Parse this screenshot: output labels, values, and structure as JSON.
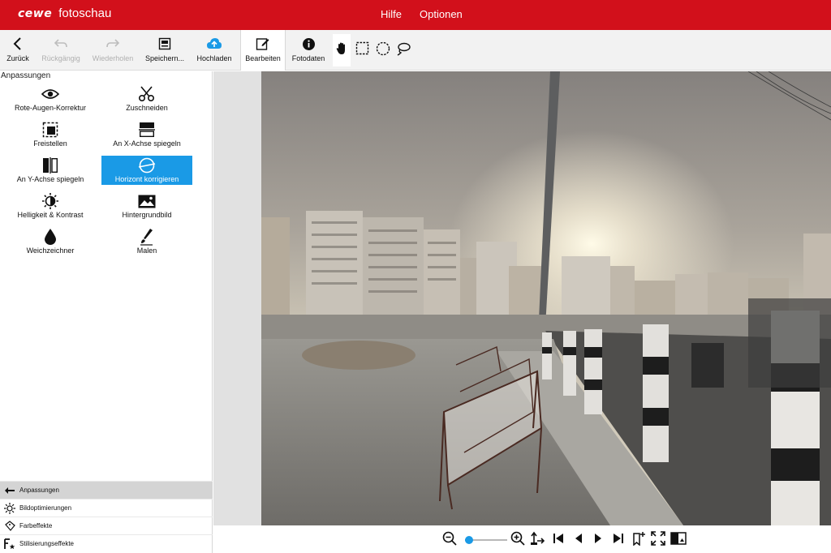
{
  "app": {
    "brand": "cewe",
    "name": "fotoschau"
  },
  "menu": {
    "items": [
      "Hilfe",
      "Optionen"
    ]
  },
  "toolbar": {
    "back": "Zurück",
    "undo": "Rückgängig",
    "redo": "Wiederholen",
    "save": "Speichern...",
    "upload": "Hochladen",
    "edit": "Bearbeiten",
    "photodata": "Fotodaten"
  },
  "panel": {
    "title": "Anpassungen",
    "tools": [
      {
        "label": "Rote-Augen-Korrektur",
        "icon": "eye-icon"
      },
      {
        "label": "Zuschneiden",
        "icon": "scissors-icon"
      },
      {
        "label": "Freistellen",
        "icon": "cutout-icon"
      },
      {
        "label": "An X-Achse spiegeln",
        "icon": "flip-x-icon"
      },
      {
        "label": "An Y-Achse spiegeln",
        "icon": "flip-y-icon"
      },
      {
        "label": "Horizont korrigieren",
        "icon": "horizon-icon"
      },
      {
        "label": "Helligkeit & Kontrast",
        "icon": "brightness-icon"
      },
      {
        "label": "Hintergrundbild",
        "icon": "image-icon"
      },
      {
        "label": "Weichzeichner",
        "icon": "drop-icon"
      },
      {
        "label": "Malen",
        "icon": "brush-icon"
      }
    ],
    "selected_tool": "Horizont korrigieren",
    "sections": [
      {
        "label": "Anpassungen",
        "icon": "arrow-left-icon"
      },
      {
        "label": "Bildoptimierungen",
        "icon": "sun-icon"
      },
      {
        "label": "Farbeffekte",
        "icon": "palette-icon"
      },
      {
        "label": "Stilisierungseffekte",
        "icon": "fx-icon"
      }
    ]
  },
  "zoom": {
    "level": 0.1
  },
  "colors": {
    "brand_red": "#d2101b",
    "accent_blue": "#1a9ae6"
  }
}
